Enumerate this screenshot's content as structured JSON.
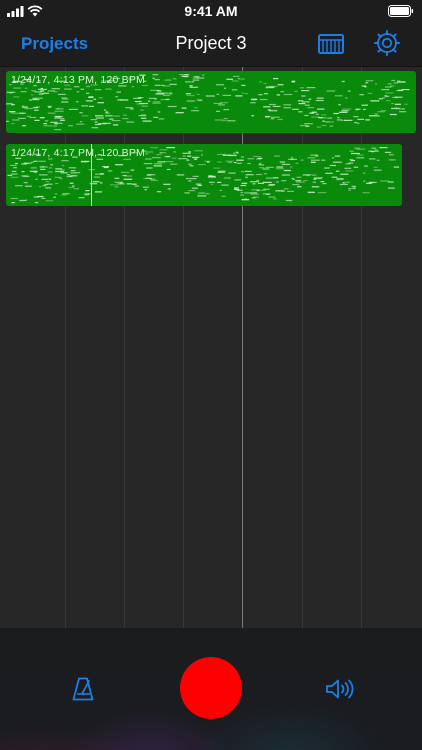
{
  "status_bar": {
    "time": "9:41 AM",
    "icons": [
      "signal-icon",
      "wifi-icon",
      "battery-icon"
    ]
  },
  "nav": {
    "back_label": "Projects",
    "title": "Project 3",
    "icons": [
      "piano-keyboard-icon",
      "settings-gear-icon"
    ]
  },
  "tracks": [
    {
      "label": "1/24/17, 4:13 PM, 120 BPM"
    },
    {
      "label": "1/24/17, 4:17 PM, 120 BPM"
    }
  ],
  "toolbar": {
    "icons": [
      "metronome-icon",
      "record-icon",
      "speaker-icon"
    ]
  },
  "colors": {
    "accent": "#1e7ee8",
    "region": "#0a8a0a",
    "record": "#ff0000",
    "cursor": "#e8f02a"
  }
}
